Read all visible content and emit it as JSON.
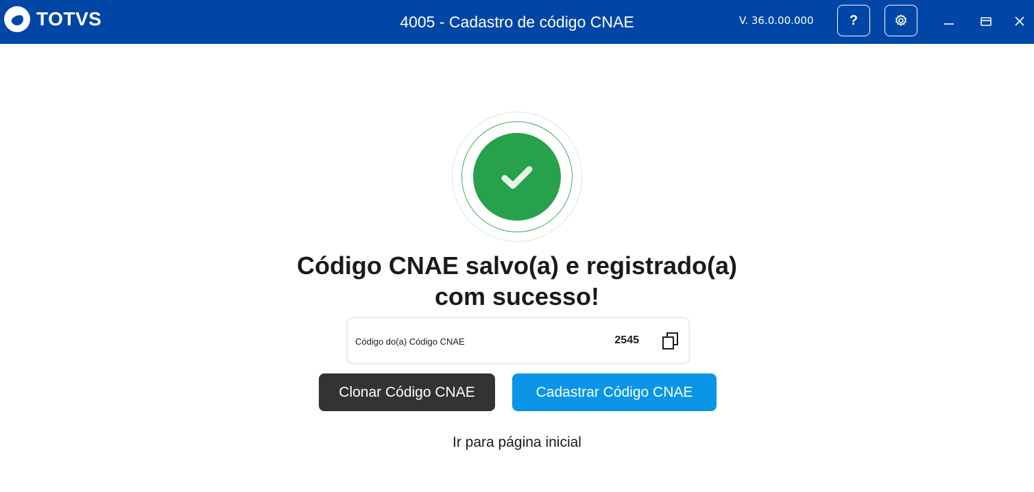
{
  "titlebar": {
    "logo_text": "TOTVS",
    "title": "4005 - Cadastro de código CNAE",
    "version": "V. 36.0.00.000",
    "help_label": "?"
  },
  "icons": {
    "logo": "totvs-logo-icon",
    "help": "question-icon",
    "settings": "gear-icon",
    "minimize": "minimize-icon",
    "maximize": "maximize-icon",
    "close": "close-icon",
    "success": "check-icon",
    "copy": "copy-icon"
  },
  "main": {
    "headline_line1": "Código CNAE salvo(a) e registrado(a)",
    "headline_line2": "com sucesso!",
    "code_label": "Código do(a) Código CNAE",
    "code_value": "2545",
    "clone_button": "Clonar Código CNAE",
    "new_button": "Cadastrar Código CNAE",
    "home_link": "Ir para página inicial"
  },
  "colors": {
    "titlebar": "#0046a6",
    "success": "#27a14b",
    "primary_button": "#0a95e6",
    "secondary_button": "#333333"
  }
}
